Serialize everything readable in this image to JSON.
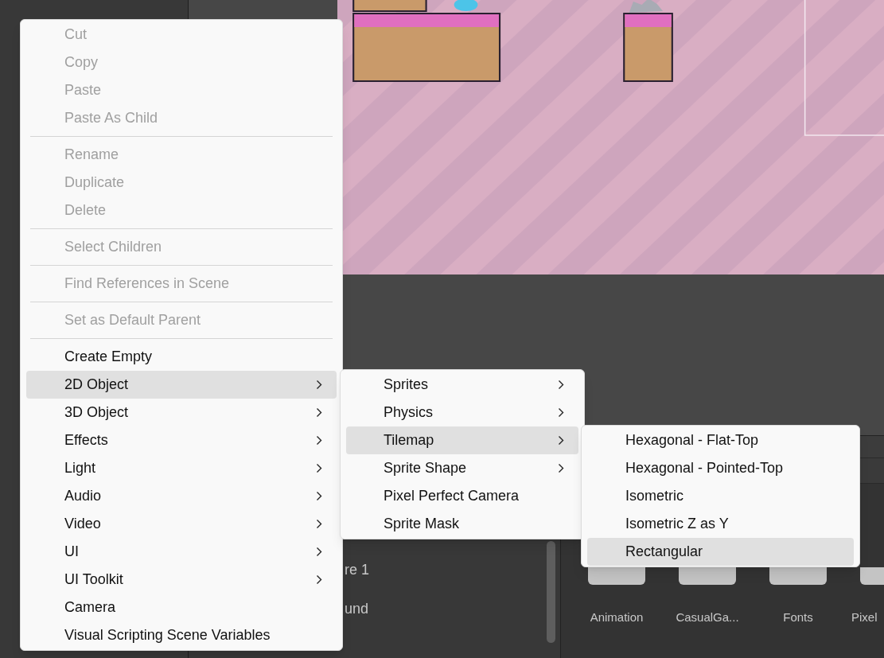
{
  "context_menu": {
    "groups": [
      [
        {
          "label": "Cut",
          "disabled": true,
          "highlighted": false,
          "has_submenu": false
        },
        {
          "label": "Copy",
          "disabled": true,
          "highlighted": false,
          "has_submenu": false
        },
        {
          "label": "Paste",
          "disabled": true,
          "highlighted": false,
          "has_submenu": false
        },
        {
          "label": "Paste As Child",
          "disabled": true,
          "highlighted": false,
          "has_submenu": false
        }
      ],
      [
        {
          "label": "Rename",
          "disabled": true,
          "highlighted": false,
          "has_submenu": false
        },
        {
          "label": "Duplicate",
          "disabled": true,
          "highlighted": false,
          "has_submenu": false
        },
        {
          "label": "Delete",
          "disabled": true,
          "highlighted": false,
          "has_submenu": false
        }
      ],
      [
        {
          "label": "Select Children",
          "disabled": true,
          "highlighted": false,
          "has_submenu": false
        }
      ],
      [
        {
          "label": "Find References in Scene",
          "disabled": true,
          "highlighted": false,
          "has_submenu": false
        }
      ],
      [
        {
          "label": "Set as Default Parent",
          "disabled": true,
          "highlighted": false,
          "has_submenu": false
        }
      ],
      [
        {
          "label": "Create Empty",
          "disabled": false,
          "highlighted": false,
          "has_submenu": false
        },
        {
          "label": "2D Object",
          "disabled": false,
          "highlighted": true,
          "has_submenu": true
        },
        {
          "label": "3D Object",
          "disabled": false,
          "highlighted": false,
          "has_submenu": true
        },
        {
          "label": "Effects",
          "disabled": false,
          "highlighted": false,
          "has_submenu": true
        },
        {
          "label": "Light",
          "disabled": false,
          "highlighted": false,
          "has_submenu": true
        },
        {
          "label": "Audio",
          "disabled": false,
          "highlighted": false,
          "has_submenu": true
        },
        {
          "label": "Video",
          "disabled": false,
          "highlighted": false,
          "has_submenu": true
        },
        {
          "label": "UI",
          "disabled": false,
          "highlighted": false,
          "has_submenu": true
        },
        {
          "label": "UI Toolkit",
          "disabled": false,
          "highlighted": false,
          "has_submenu": true
        },
        {
          "label": "Camera",
          "disabled": false,
          "highlighted": false,
          "has_submenu": false
        },
        {
          "label": "Visual Scripting Scene Variables",
          "disabled": false,
          "highlighted": false,
          "has_submenu": false
        }
      ]
    ]
  },
  "submenu_2d_object": [
    {
      "label": "Sprites",
      "highlighted": false,
      "has_submenu": true
    },
    {
      "label": "Physics",
      "highlighted": false,
      "has_submenu": true
    },
    {
      "label": "Tilemap",
      "highlighted": true,
      "has_submenu": true
    },
    {
      "label": "Sprite Shape",
      "highlighted": false,
      "has_submenu": true
    },
    {
      "label": "Pixel Perfect Camera",
      "highlighted": false,
      "has_submenu": false
    },
    {
      "label": "Sprite Mask",
      "highlighted": false,
      "has_submenu": false
    }
  ],
  "submenu_tilemap": [
    {
      "label": "Hexagonal - Flat-Top",
      "highlighted": false,
      "has_submenu": false
    },
    {
      "label": "Hexagonal - Pointed-Top",
      "highlighted": false,
      "has_submenu": false
    },
    {
      "label": "Isometric",
      "highlighted": false,
      "has_submenu": false
    },
    {
      "label": "Isometric Z as Y",
      "highlighted": false,
      "has_submenu": false
    },
    {
      "label": "Rectangular",
      "highlighted": true,
      "has_submenu": false
    }
  ],
  "hierarchy_items": [
    "re 1",
    "und"
  ],
  "project_folders": [
    "Animation",
    "CasualGa...",
    "Fonts",
    "Pixel"
  ]
}
